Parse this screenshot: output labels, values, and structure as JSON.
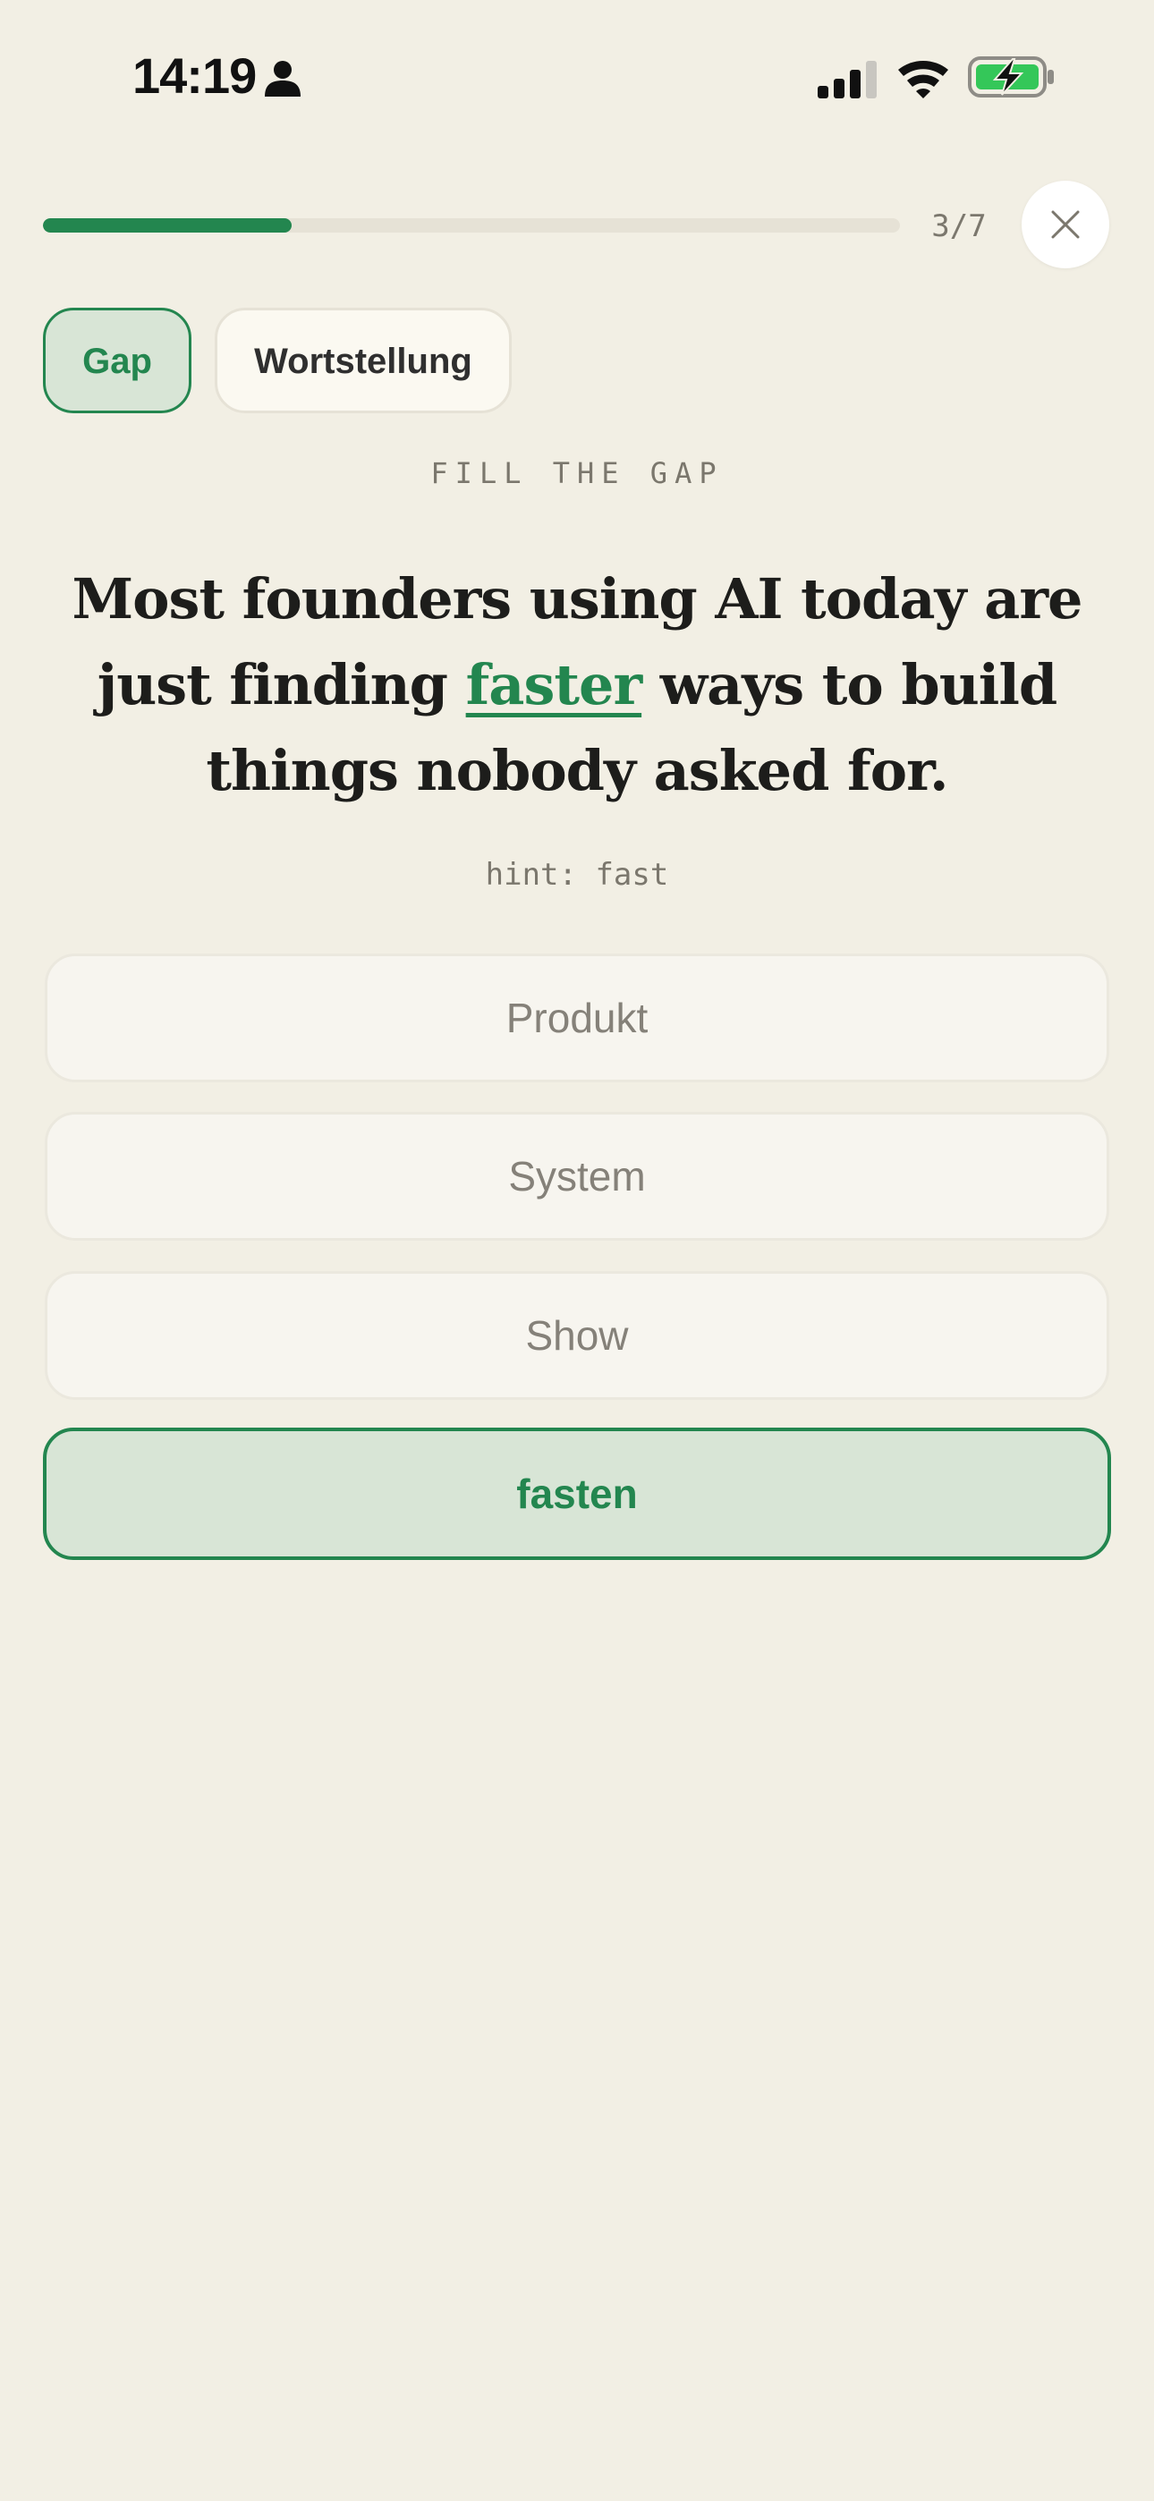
{
  "status_bar": {
    "time": "14:19",
    "icons": [
      "person-icon",
      "cellular-signal-icon",
      "wifi-icon",
      "battery-charging-icon"
    ]
  },
  "progress": {
    "label": "3/7",
    "fraction": 0.29
  },
  "close_button": {
    "icon": "close-icon"
  },
  "modes": {
    "active": "Gap",
    "inactive": "Wortstellung"
  },
  "exercise": {
    "instruction": "FILL THE GAP",
    "sentence_before": "Most founders using AI today are just finding ",
    "gap_word": "faster",
    "sentence_after": " ways to build things nobody asked for.",
    "hint": "hint: fast"
  },
  "options": [
    {
      "label": "Produkt",
      "selected": false
    },
    {
      "label": "System",
      "selected": false
    },
    {
      "label": "Show",
      "selected": false
    },
    {
      "label": "fasten",
      "selected": true
    }
  ],
  "colors": {
    "accent": "#23864f",
    "accent_bg": "#d8e5d6",
    "page_bg": "#f2efe4",
    "muted_text": "#7b776d"
  }
}
